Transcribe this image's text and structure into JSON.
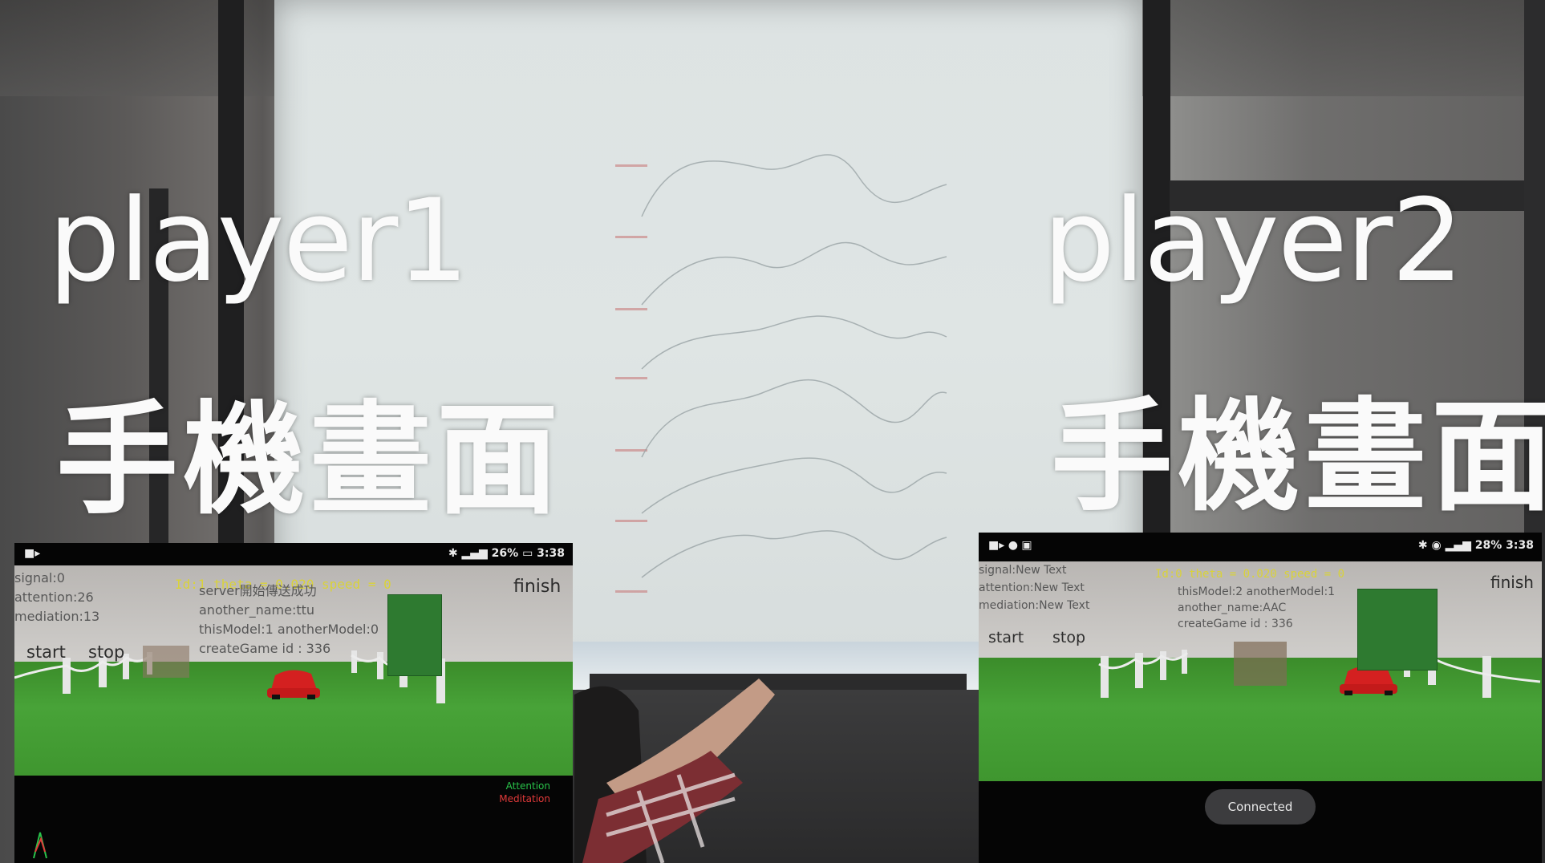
{
  "overlay": {
    "left_player": "player1",
    "left_caption": "手機畫面",
    "right_player": "player2",
    "right_caption": "手機畫面"
  },
  "player1_phone": {
    "status_time": "3:38",
    "battery": "26%",
    "info_lines": [
      "signal:0",
      "attention:26",
      "mediation:13"
    ],
    "server_lines": [
      "server開始傳送成功",
      "another_name:ttu",
      "thisModel:1 anotherModel:0",
      "createGame id : 336"
    ],
    "hud_yellow": "Id:1 theta = 0.020 speed = 0",
    "start_label": "start",
    "stop_label": "stop",
    "finish_label": "finish",
    "legend_attention": "Attention",
    "legend_meditation": "Meditation"
  },
  "player2_phone": {
    "status_time": "3:38",
    "battery": "28%",
    "info_lines": [
      "signal:New Text",
      "attention:New Text",
      "mediation:New Text"
    ],
    "server_lines": [
      "thisModel:2 anotherModel:1",
      "another_name:AAC",
      "createGame id : 336"
    ],
    "hud_yellow": "Id:0 theta = 0.020 speed = 0",
    "start_label": "start",
    "stop_label": "stop",
    "finish_label": "finish",
    "toast": "Connected"
  },
  "colors": {
    "overlay_text": "#fafafa",
    "grass": "#45a035",
    "hud_yellow": "#d9d23a",
    "attention_green": "#29c34a",
    "meditation_red": "#e23a3a"
  }
}
